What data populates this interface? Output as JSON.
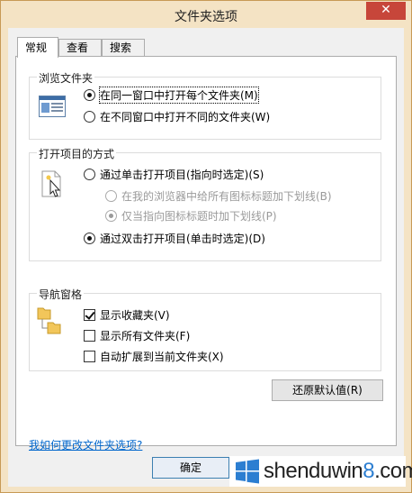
{
  "window": {
    "title": "文件夹选项",
    "close_glyph": "✕"
  },
  "tabs": [
    {
      "label": "常规",
      "active": true
    },
    {
      "label": "查看",
      "active": false
    },
    {
      "label": "搜索",
      "active": false
    }
  ],
  "browse_group": {
    "label": "浏览文件夹",
    "options": [
      {
        "label": "在同一窗口中打开每个文件夹(M)",
        "selected": true
      },
      {
        "label": "在不同窗口中打开不同的文件夹(W)",
        "selected": false
      }
    ]
  },
  "click_group": {
    "label": "打开项目的方式",
    "options": [
      {
        "label": "通过单击打开项目(指向时选定)(S)",
        "selected": false,
        "enabled": true
      },
      {
        "label": "在我的浏览器中给所有图标标题加下划线(B)",
        "selected": false,
        "enabled": false
      },
      {
        "label": "仅当指向图标标题时加下划线(P)",
        "selected": true,
        "enabled": false
      },
      {
        "label": "通过双击打开项目(单击时选定)(D)",
        "selected": true,
        "enabled": true
      }
    ]
  },
  "nav_group": {
    "label": "导航窗格",
    "options": [
      {
        "label": "显示收藏夹(V)",
        "checked": true
      },
      {
        "label": "显示所有文件夹(F)",
        "checked": false
      },
      {
        "label": "自动扩展到当前文件夹(X)",
        "checked": false
      }
    ]
  },
  "restore_button": "还原默认值(R)",
  "help_link": "我如何更改文件夹选项?",
  "ok_button": "确定",
  "watermark": {
    "prefix": "shenduwin",
    "highlight": "8",
    "suffix": ".com"
  },
  "colors": {
    "frame": "#f4e3c4",
    "close": "#c7463a",
    "link": "#0066cc",
    "accent": "#2c7ed1"
  }
}
